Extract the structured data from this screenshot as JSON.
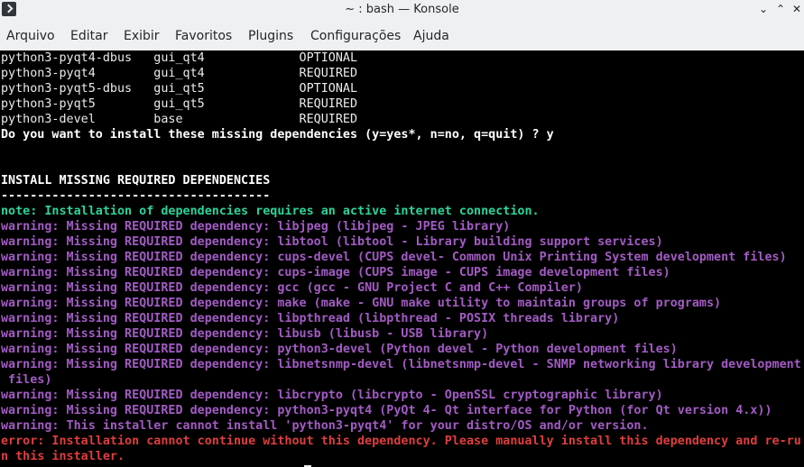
{
  "window": {
    "title": "~ : bash — Konsole",
    "minimize_glyph": "⌄",
    "maximize_glyph": "⌃",
    "close_glyph": "✕"
  },
  "menu": {
    "items": [
      "Arquivo",
      "Editar",
      "Exibir",
      "Favoritos",
      "Plugins",
      "Configurações",
      "Ajuda"
    ]
  },
  "colors": {
    "note": "#2ad49a",
    "warning": "#a35bc4",
    "error": "#e03d3d",
    "text": "#ebebeb"
  },
  "terminal": {
    "lines": [
      {
        "text": "python3-pyqt4-dbus   gui_qt4             OPTIONAL",
        "style": "plain"
      },
      {
        "text": "python3-pyqt4        gui_qt4             REQUIRED",
        "style": "plain"
      },
      {
        "text": "python3-pyqt5-dbus   gui_qt5             OPTIONAL",
        "style": "plain"
      },
      {
        "text": "python3-pyqt5        gui_qt5             REQUIRED",
        "style": "plain"
      },
      {
        "text": "python3-devel        base                REQUIRED",
        "style": "plain"
      },
      {
        "text": "Do you want to install these missing dependencies (y=yes*, n=no, q=quit) ? y",
        "style": "bold"
      },
      {
        "text": "",
        "style": "plain"
      },
      {
        "text": "",
        "style": "plain"
      },
      {
        "text": "INSTALL MISSING REQUIRED DEPENDENCIES",
        "style": "bold"
      },
      {
        "text": "-------------------------------------",
        "style": "bold"
      },
      {
        "text": "note: Installation of dependencies requires an active internet connection.",
        "style": "note"
      },
      {
        "text": "warning: Missing REQUIRED dependency: libjpeg (libjpeg - JPEG library)",
        "style": "warning"
      },
      {
        "text": "warning: Missing REQUIRED dependency: libtool (libtool - Library building support services)",
        "style": "warning"
      },
      {
        "text": "warning: Missing REQUIRED dependency: cups-devel (CUPS devel- Common Unix Printing System development files)",
        "style": "warning"
      },
      {
        "text": "warning: Missing REQUIRED dependency: cups-image (CUPS image - CUPS image development files)",
        "style": "warning"
      },
      {
        "text": "warning: Missing REQUIRED dependency: gcc (gcc - GNU Project C and C++ Compiler)",
        "style": "warning"
      },
      {
        "text": "warning: Missing REQUIRED dependency: make (make - GNU make utility to maintain groups of programs)",
        "style": "warning"
      },
      {
        "text": "warning: Missing REQUIRED dependency: libpthread (libpthread - POSIX threads library)",
        "style": "warning"
      },
      {
        "text": "warning: Missing REQUIRED dependency: libusb (libusb - USB library)",
        "style": "warning"
      },
      {
        "text": "warning: Missing REQUIRED dependency: python3-devel (Python devel - Python development files)",
        "style": "warning"
      },
      {
        "text": "warning: Missing REQUIRED dependency: libnetsnmp-devel (libnetsnmp-devel - SNMP networking library development",
        "style": "warning"
      },
      {
        "text": " files)",
        "style": "warning"
      },
      {
        "text": "warning: Missing REQUIRED dependency: libcrypto (libcrypto - OpenSSL cryptographic library)",
        "style": "warning"
      },
      {
        "text": "warning: Missing REQUIRED dependency: python3-pyqt4 (PyQt 4- Qt interface for Python (for Qt version 4.x))",
        "style": "warning"
      },
      {
        "text": "warning: This installer cannot install 'python3-pyqt4' for your distro/OS and/or version.",
        "style": "warning"
      },
      {
        "text": "error: Installation cannot continue without this dependency. Please manually install this dependency and re-ru",
        "style": "error"
      },
      {
        "text": "n this installer.",
        "style": "error"
      }
    ]
  }
}
